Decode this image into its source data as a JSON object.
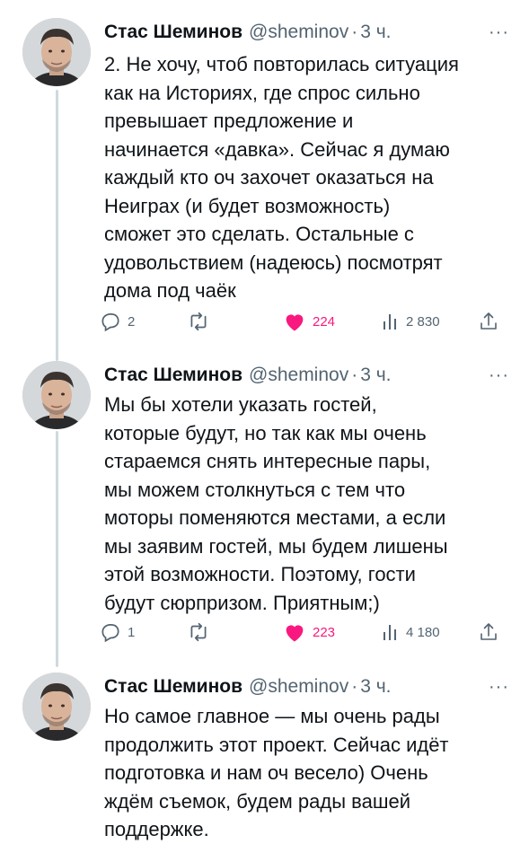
{
  "tweets": [
    {
      "author_name": "Стас Шеминов",
      "handle": "@sheminov",
      "dot": "·",
      "time": "3 ч.",
      "more": "···",
      "text": "2. Не хочу, чтоб повторилась ситуация\nкак на Историях, где спрос сильно\nпревышает предложение и\nначинается «давка». Сейчас я думаю\nкаждый кто оч захочет оказаться на\nНеиграх (и будет возможность)\nсможет это сделать. Остальные с\nудовольствием (надеюсь) посмотрят\nдома под чаёк",
      "replies": "2",
      "retweets": "",
      "likes": "224",
      "views": "2 830"
    },
    {
      "author_name": "Стас Шеминов",
      "handle": "@sheminov",
      "dot": "·",
      "time": "3 ч.",
      "more": "···",
      "text": "Мы бы хотели указать гостей,\nкоторые будут, но так как мы очень\nстараемся снять интересные пары,\nмы можем столкнуться с тем что\nмоторы поменяются местами, а если\nмы заявим гостей, мы будем лишены\nэтой возможности. Поэтому, гости\nбудут сюрпризом. Приятным;)",
      "replies": "1",
      "retweets": "",
      "likes": "223",
      "views": "4 180"
    },
    {
      "author_name": "Стас Шеминов",
      "handle": "@sheminov",
      "dot": "·",
      "time": "3 ч.",
      "more": "···",
      "text": "Но самое главное — мы очень рады\nпродолжить этот проект. Сейчас идёт\nподготовка и нам оч весело) Очень\nждём съемок, будем рады вашей\nподдержке."
    }
  ],
  "colors": {
    "text": "#0f1419",
    "secondary": "#536471",
    "like": "#f91880",
    "thread_line": "#cfd9de"
  },
  "icons": [
    "reply-icon",
    "retweet-icon",
    "heart-filled-icon",
    "views-icon",
    "share-icon",
    "more-icon"
  ]
}
